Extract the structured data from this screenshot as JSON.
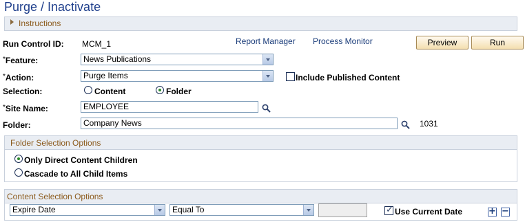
{
  "page": {
    "title": "Purge / Inactivate"
  },
  "instructions": {
    "label": "Instructions"
  },
  "run_control": {
    "label": "Run Control ID:",
    "value": "MCM_1"
  },
  "links": {
    "report_manager": "Report Manager",
    "process_monitor": "Process Monitor"
  },
  "buttons": {
    "preview": "Preview",
    "run": "Run"
  },
  "feature": {
    "label": "Feature:",
    "required_mark": "*",
    "value": "News Publications"
  },
  "action": {
    "label": "Action:",
    "required_mark": "*",
    "value": "Purge Items"
  },
  "include_published": {
    "label": "Include Published Content",
    "checked": false
  },
  "selection": {
    "label": "Selection:",
    "options": [
      {
        "label": "Content",
        "selected": false
      },
      {
        "label": "Folder",
        "selected": true
      }
    ]
  },
  "site_name": {
    "label": "Site Name:",
    "required_mark": "*",
    "value": "EMPLOYEE"
  },
  "folder": {
    "label": "Folder:",
    "value": "Company News",
    "id": "1031"
  },
  "folder_selection": {
    "title": "Folder Selection Options",
    "options": [
      {
        "label": "Only Direct Content Children",
        "selected": true
      },
      {
        "label": "Cascade to All Child Items",
        "selected": false
      }
    ]
  },
  "content_selection": {
    "title": "Content Selection Options",
    "field": "Expire Date",
    "operator": "Equal To",
    "value": "",
    "use_current_date": {
      "label": "Use Current Date",
      "checked": true
    },
    "add_label": "+",
    "remove_label": "−"
  },
  "icons": {
    "expand": "triangle-right-icon",
    "lookup": "magnifier-icon",
    "dropdown": "chevron-down-icon"
  },
  "colors": {
    "title": "#1f3f8c",
    "section_title": "#8b5a1c",
    "link": "#1a3c7a",
    "bar_bg": "#e9edf3"
  }
}
